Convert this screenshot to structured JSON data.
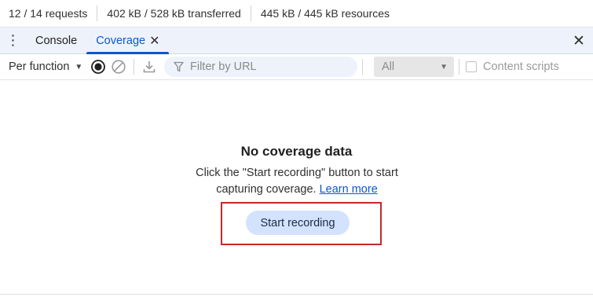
{
  "status": {
    "requests": "12 / 14 requests",
    "transferred": "402 kB / 528 kB transferred",
    "resources": "445 kB / 445 kB resources"
  },
  "tabs": [
    {
      "label": "Console",
      "active": false
    },
    {
      "label": "Coverage",
      "active": true
    }
  ],
  "toolbar": {
    "mode": "Per function",
    "filter_placeholder": "Filter by URL",
    "type_value": "All",
    "content_scripts_label": "Content scripts",
    "content_scripts_checked": false
  },
  "empty_state": {
    "title": "No coverage data",
    "description": "Click the \"Start recording\" button to start capturing coverage.",
    "learn_more": "Learn more",
    "button": "Start recording"
  },
  "colors": {
    "accent": "#0b57d0",
    "tabbar_bg": "#eef2fb",
    "button_bg": "#d3e3fd",
    "highlight": "#c62828"
  },
  "icons": {
    "more": "kebab-menu-icon",
    "record": "record-icon",
    "clear": "clear-icon",
    "export": "download-icon",
    "filter": "filter-icon",
    "close": "close-icon"
  }
}
